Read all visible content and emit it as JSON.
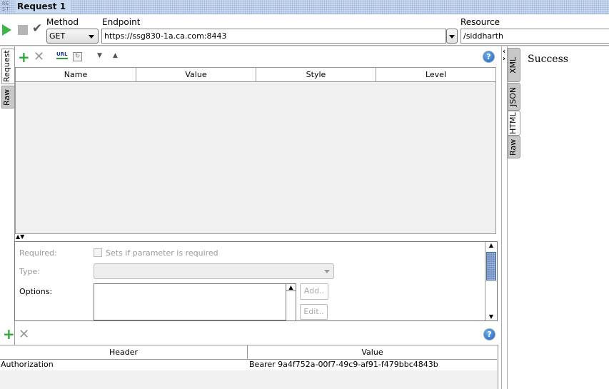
{
  "window": {
    "icon_text": "RE ST",
    "title": "Request 1"
  },
  "toolbar": {
    "method_label": "Method",
    "method_value": "GET",
    "endpoint_label": "Endpoint",
    "endpoint_value": "https://ssg830-1a.ca.com:8443",
    "resource_label": "Resource",
    "resource_value": "/siddharth"
  },
  "left_tabs": [
    "Request",
    "Raw"
  ],
  "params": {
    "columns": [
      "Name",
      "Value",
      "Style",
      "Level"
    ],
    "url_icon_text": "URL"
  },
  "detail": {
    "required_label": "Required:",
    "required_checkbox_label": "Sets if parameter is required",
    "type_label": "Type:",
    "options_label": "Options:",
    "add_label": "Add..",
    "edit_label": "Edit.."
  },
  "headers": {
    "columns": [
      "Header",
      "Value"
    ],
    "rows": [
      {
        "header": "Authorization",
        "value": "Bearer 9a4f752a-00f7-49c9-af91-f479bbc4843b"
      }
    ]
  },
  "response": {
    "tabs": [
      "XML",
      "JSON",
      "HTML",
      "Raw"
    ],
    "selected_tab": "HTML",
    "content": "Success"
  }
}
